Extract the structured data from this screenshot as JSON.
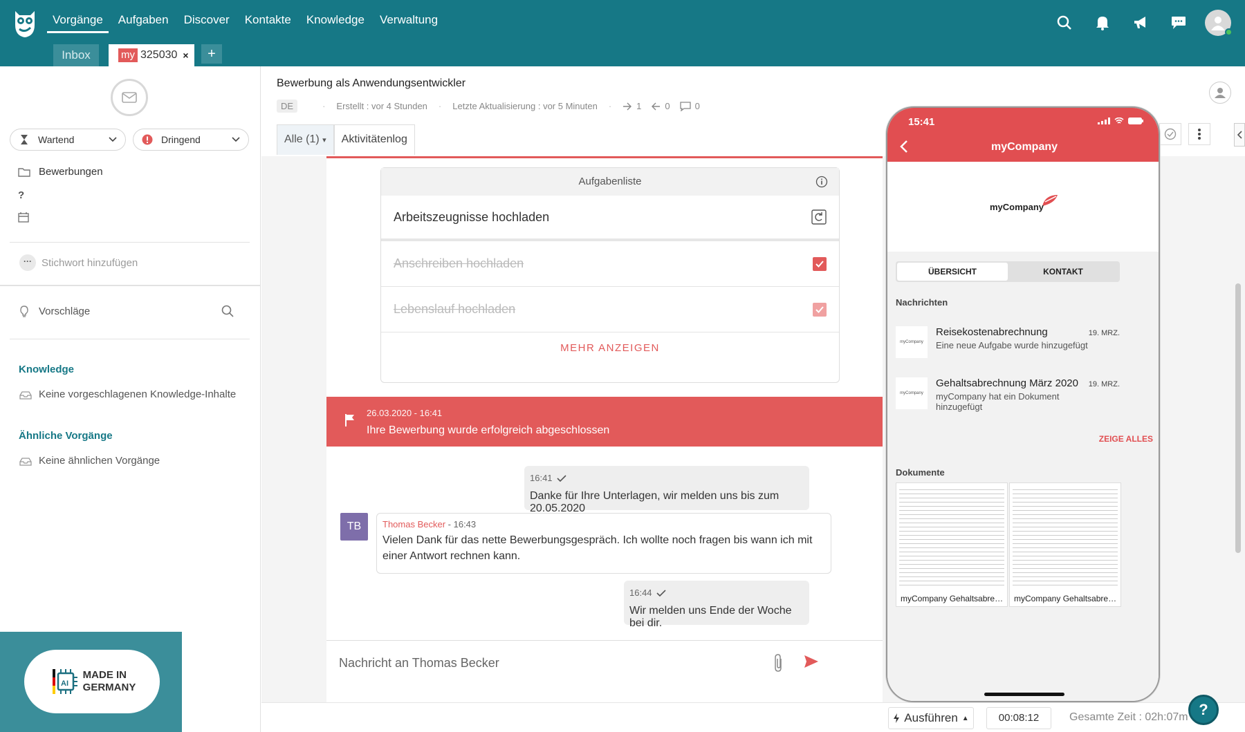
{
  "topnav": {
    "items": [
      "Vorgänge",
      "Aufgaben",
      "Discover",
      "Kontakte",
      "Knowledge",
      "Verwaltung"
    ],
    "active": 0
  },
  "tabs": {
    "inbox": "Inbox",
    "case_badge": "my",
    "case_id": "325030",
    "close": "×",
    "add": "+"
  },
  "left": {
    "status": "Wartend",
    "priority": "Dringend",
    "folder": "Bewerbungen",
    "unknown": "?",
    "keyword_placeholder": "Stichwort hinzufügen",
    "keyword_dots": "···",
    "suggestions": "Vorschläge",
    "knowledge_title": "Knowledge",
    "knowledge_empty": "Keine vorgeschlagenen Knowledge-Inhalte",
    "similar_title": "Ähnliche Vorgänge",
    "similar_empty": "Keine ähnlichen Vorgänge",
    "made_in": "MADE IN",
    "germany": "GERMANY",
    "ai": "AI"
  },
  "case": {
    "title": "Bewerbung als Anwendungsentwickler",
    "lang": "DE",
    "created": "Erstellt : vor 4 Stunden",
    "updated": "Letzte Aktualisierung : vor 5 Minuten",
    "out": "1",
    "in": "0",
    "comments": "0",
    "tab_all": "Alle (1)",
    "tab_log": "Aktivitätenlog"
  },
  "tasklist": {
    "title": "Aufgabenliste",
    "tasks": [
      {
        "label": "Arbeitszeugnisse hochladen",
        "done": false
      },
      {
        "label": "Anschreiben hochladen",
        "done": true
      },
      {
        "label": "Lebenslauf hochladen",
        "done": true
      }
    ],
    "more": "MEHR ANZEIGEN"
  },
  "banner": {
    "date": "26.03.2020 - 16:41",
    "text": "Ihre Bewerbung wurde erfolgreich abgeschlossen"
  },
  "messages": [
    {
      "time": "16:41",
      "text": "Danke für Ihre Unterlagen, wir melden uns bis zum 20.05.2020"
    },
    {
      "initials": "TB",
      "name": "Thomas Becker",
      "time": "- 16:43",
      "text": "Vielen Dank für das nette Bewerbungsgespräch. Ich wollte noch fragen bis wann ich mit einer Antwort rechnen kann."
    },
    {
      "time": "16:44",
      "text": "Wir melden uns Ende der Woche bei dir."
    }
  ],
  "composer": {
    "placeholder": "Nachricht an Thomas Becker"
  },
  "footer": {
    "execute": "Ausführen",
    "timer": "00:08:12",
    "total": "Gesamte Zeit : 02h:07m",
    "help": "?"
  },
  "phone": {
    "clock": "15:41",
    "app": "myCompany",
    "logo": "myCompany",
    "seg": [
      "ÜBERSICHT",
      "KONTAKT"
    ],
    "news_title": "Nachrichten",
    "news": [
      {
        "title": "Reisekostenabrechnung",
        "sub": "Eine neue Aufgabe wurde hinzugefügt",
        "date": "19. MRZ.",
        "icon": "myCompany"
      },
      {
        "title": "Gehaltsabrechnung März 2020",
        "sub": "myCompany hat ein Dokument hinzugefügt",
        "date": "19. MRZ.",
        "icon": "myCompany"
      }
    ],
    "show_all": "ZEIGE ALLES",
    "docs_title": "Dokumente",
    "docs": [
      "myCompany Gehaltsabrec...",
      "myCompany Gehaltsabrec..."
    ]
  },
  "colors": {
    "teal": "#167886",
    "red": "#e25a5a",
    "purple": "#7e6eaa"
  }
}
